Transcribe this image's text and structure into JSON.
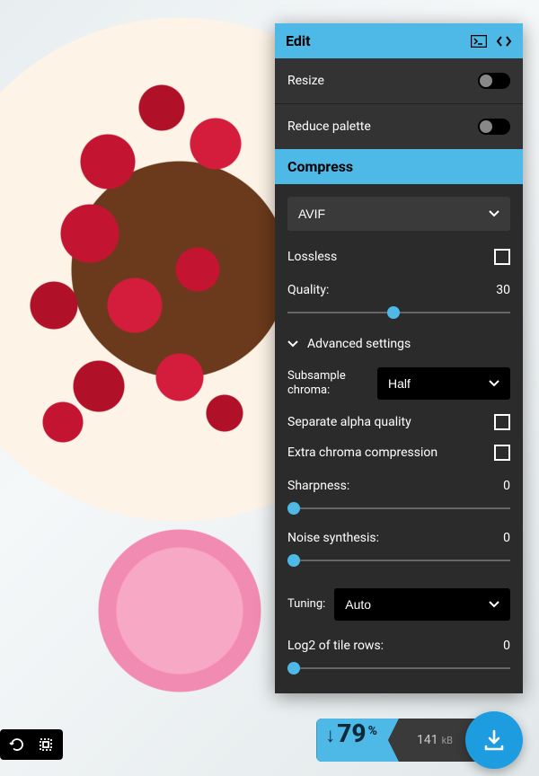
{
  "panel": {
    "title": "Edit",
    "resize": {
      "label": "Resize",
      "enabled": false
    },
    "reduce_palette": {
      "label": "Reduce palette",
      "enabled": false
    },
    "compress_label": "Compress",
    "format": {
      "selected": "AVIF"
    },
    "lossless": {
      "label": "Lossless",
      "checked": false
    },
    "quality": {
      "label": "Quality:",
      "value": 30,
      "min": 0,
      "max": 63
    },
    "advanced_label": "Advanced settings",
    "subsample_chroma": {
      "label": "Subsample chroma:",
      "selected": "Half"
    },
    "separate_alpha": {
      "label": "Separate alpha quality",
      "checked": false
    },
    "extra_chroma": {
      "label": "Extra chroma compression",
      "checked": false
    },
    "sharpness": {
      "label": "Sharpness:",
      "value": 0,
      "min": 0,
      "max": 7
    },
    "noise_synthesis": {
      "label": "Noise synthesis:",
      "value": 0,
      "min": 0,
      "max": 50
    },
    "tuning": {
      "label": "Tuning:",
      "selected": "Auto"
    },
    "log2_tile_rows": {
      "label": "Log2 of tile rows:",
      "value": 0,
      "min": 0,
      "max": 6
    }
  },
  "output": {
    "savings_pct": "79",
    "size_value": "141",
    "size_unit": "kB"
  }
}
